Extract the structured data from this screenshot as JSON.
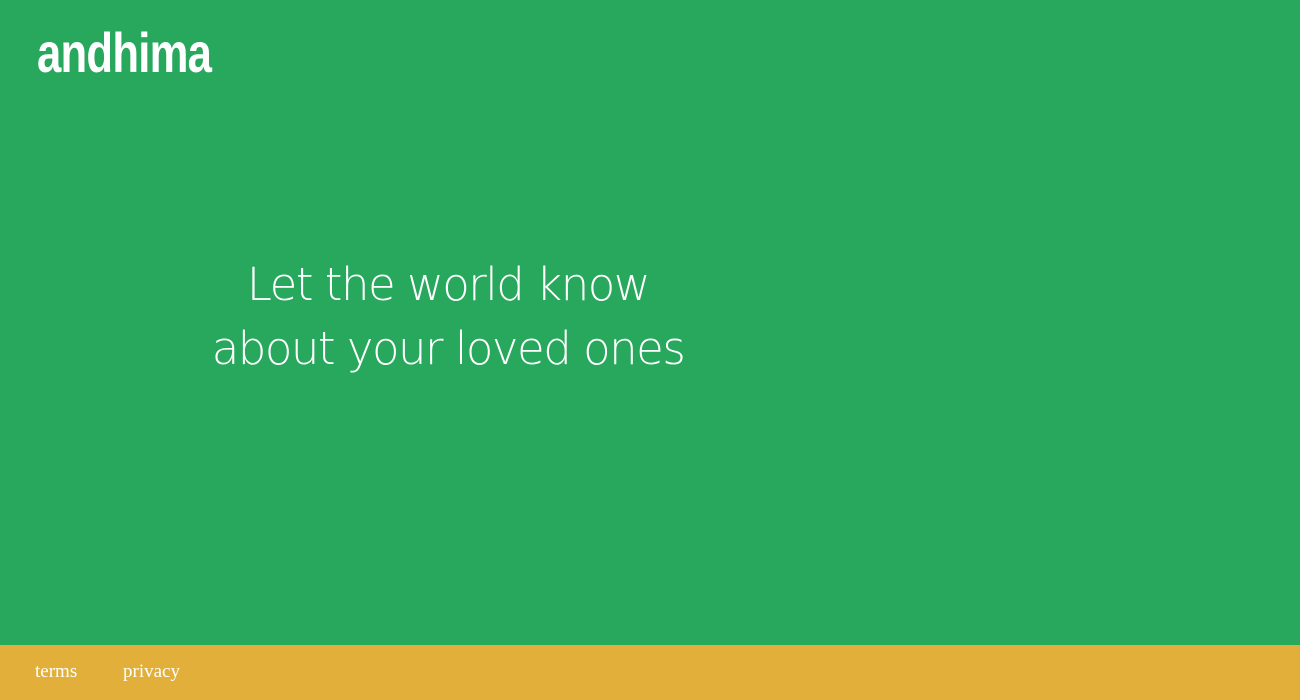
{
  "brand": {
    "name": "andhima"
  },
  "hero": {
    "line1": "Let the world know",
    "line2": "about your loved ones"
  },
  "footer": {
    "links": [
      {
        "label": "terms"
      },
      {
        "label": "privacy"
      }
    ]
  },
  "colors": {
    "background": "#27a85c",
    "footer": "#e2b03a",
    "text": "#ffffff"
  }
}
